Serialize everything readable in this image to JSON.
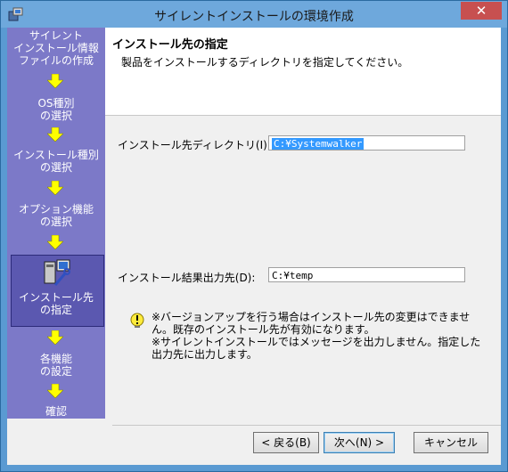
{
  "window": {
    "title": "サイレントインストールの環境作成",
    "close_label": "✕"
  },
  "steps": [
    {
      "lines": [
        "サイレント",
        "インストール情報",
        "ファイルの作成"
      ]
    },
    {
      "lines": [
        "OS種別",
        "の選択"
      ]
    },
    {
      "lines": [
        "インストール種別",
        "の選択"
      ]
    },
    {
      "lines": [
        "オプション機能",
        "の選択"
      ]
    },
    {
      "lines": [
        "インストール先",
        "の指定"
      ]
    },
    {
      "lines": [
        "各機能",
        "の設定"
      ]
    },
    {
      "lines": [
        "確認"
      ]
    }
  ],
  "header": {
    "title": "インストール先の指定",
    "subtitle": "製品をインストールするディレクトリを指定してください。"
  },
  "form": {
    "install_dir_label": "インストール先ディレクトリ(I):",
    "install_dir_value": "C:¥Systemwalker",
    "output_label": "インストール結果出力先(D):",
    "output_value": "C:¥temp"
  },
  "note": {
    "lines": [
      "※バージョンアップを行う場合はインストール先の変更はできませ",
      "ん。既存のインストール先が有効になります。",
      "※サイレントインストールではメッセージを出力しません。指定した",
      "出力先に出力します。"
    ]
  },
  "buttons": {
    "back": "< 戻る(B)",
    "next": "次へ(N) >",
    "cancel": "キャンセル"
  },
  "colors": {
    "step_panel": "#7c79c8",
    "arrow": "#ffff00"
  }
}
